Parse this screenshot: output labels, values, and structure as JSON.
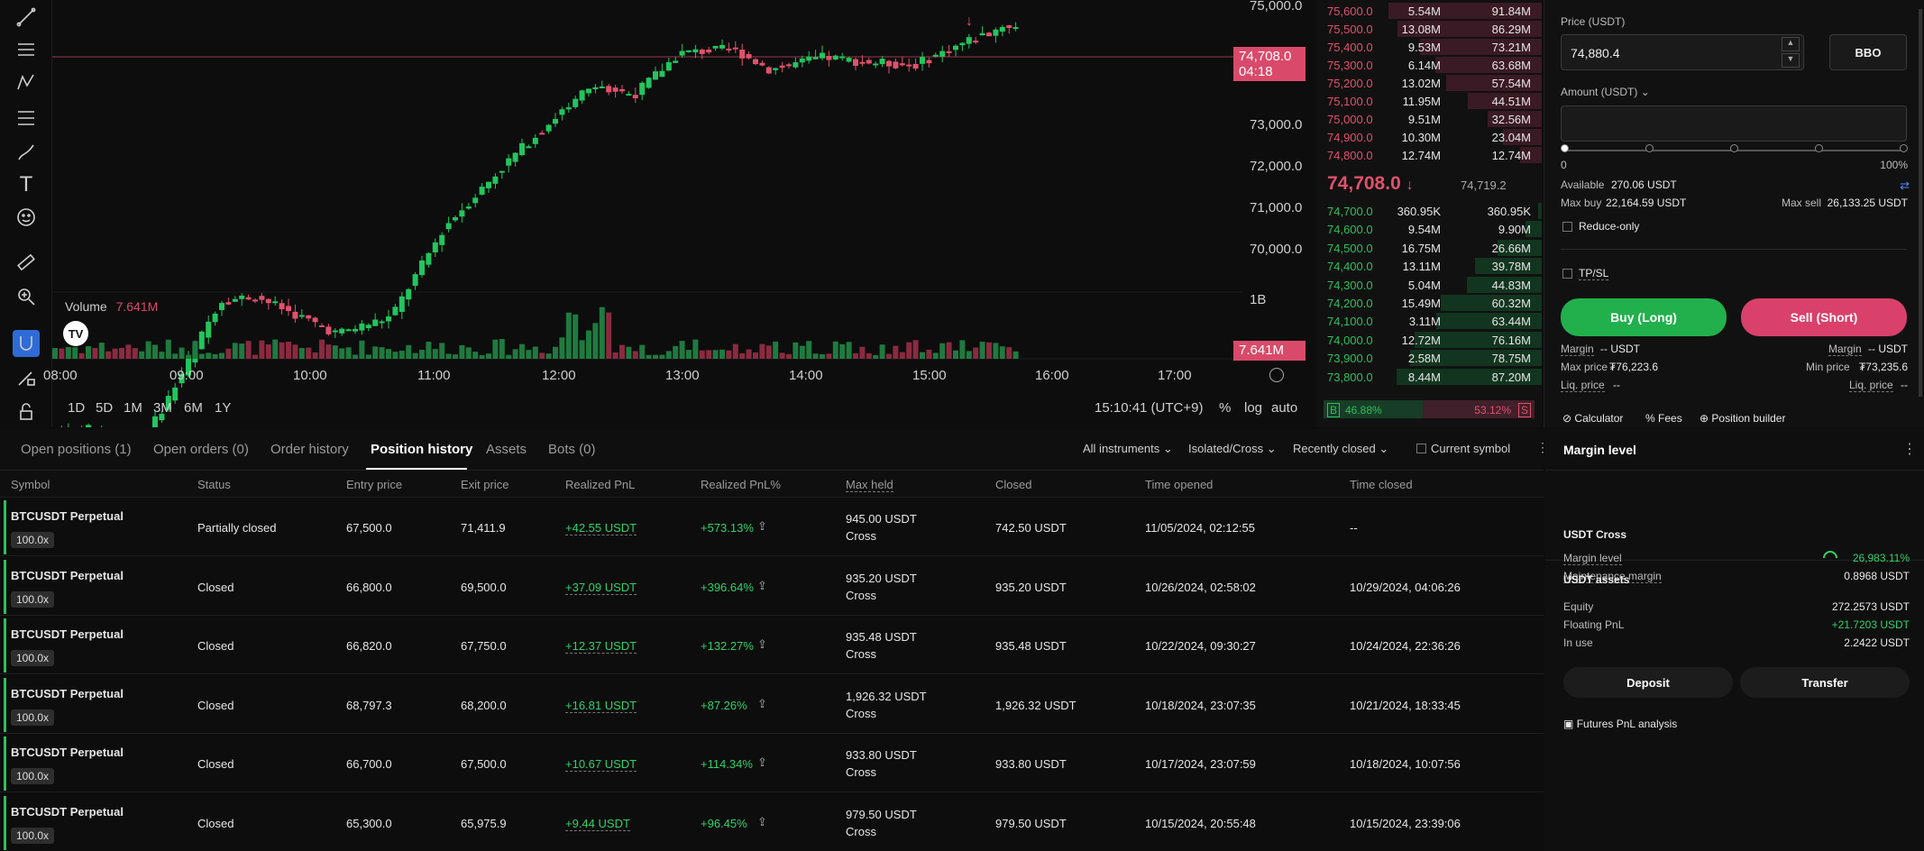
{
  "toolbar": {
    "icons": [
      "trend-line-icon",
      "horizontal-lines-icon",
      "pattern-icon",
      "fib-icon",
      "brush-icon",
      "text-icon",
      "emoji-icon",
      "ruler-icon",
      "zoom-in-icon",
      "magnet-icon",
      "lock-draw-icon",
      "lock-icon"
    ]
  },
  "chart": {
    "price_axis": [
      "75,000.0",
      "74,000.0",
      "73,000.0",
      "72,000.0",
      "71,000.0",
      "70,000.0"
    ],
    "last_price": "74,708.0",
    "countdown": "04:18",
    "volume_label": "Volume",
    "volume_value": "7.641M",
    "volume_axis": "1B",
    "volume_tag": "7.641M",
    "time_labels": [
      "08:00",
      "09:00",
      "10:00",
      "11:00",
      "12:00",
      "13:00",
      "14:00",
      "15:00",
      "16:00",
      "17:00"
    ],
    "timeframes": [
      "1D",
      "5D",
      "1M",
      "3M",
      "6M",
      "1Y"
    ],
    "clock": "15:10:41 (UTC+9)",
    "scale_pct": "%",
    "scale_log": "log",
    "scale_auto": "auto",
    "tv_logo": "TV"
  },
  "orderbook": {
    "asks": [
      [
        "75,600.0",
        "5.54M",
        "91.84M"
      ],
      [
        "75,500.0",
        "13.08M",
        "86.29M"
      ],
      [
        "75,400.0",
        "9.53M",
        "73.21M"
      ],
      [
        "75,300.0",
        "6.14M",
        "63.68M"
      ],
      [
        "75,200.0",
        "13.02M",
        "57.54M"
      ],
      [
        "75,100.0",
        "11.95M",
        "44.51M"
      ],
      [
        "75,000.0",
        "9.51M",
        "32.56M"
      ],
      [
        "74,900.0",
        "10.30M",
        "23.04M"
      ],
      [
        "74,800.0",
        "12.74M",
        "12.74M"
      ]
    ],
    "mid_price": "74,708.0",
    "mid_arrow": "↓",
    "mark_price": "74,719.2",
    "bids": [
      [
        "74,700.0",
        "360.95K",
        "360.95K"
      ],
      [
        "74,600.0",
        "9.54M",
        "9.90M"
      ],
      [
        "74,500.0",
        "16.75M",
        "26.66M"
      ],
      [
        "74,400.0",
        "13.11M",
        "39.78M"
      ],
      [
        "74,300.0",
        "5.04M",
        "44.83M"
      ],
      [
        "74,200.0",
        "15.49M",
        "60.32M"
      ],
      [
        "74,100.0",
        "3.11M",
        "63.44M"
      ],
      [
        "74,000.0",
        "12.72M",
        "76.16M"
      ],
      [
        "73,900.0",
        "2.58M",
        "78.75M"
      ],
      [
        "73,800.0",
        "8.44M",
        "87.20M"
      ]
    ],
    "buy_ratio_label": "B",
    "buy_ratio": "46.88%",
    "sell_ratio": "53.12%",
    "sell_ratio_label": "S"
  },
  "form": {
    "price_label": "Price (USDT)",
    "price_value": "74,880.4",
    "bbo": "BBO",
    "amount_label": "Amount (USDT)",
    "slider_min": "0",
    "slider_max": "100%",
    "available_label": "Available",
    "available_value": "270.06 USDT",
    "max_buy_label": "Max buy",
    "max_buy_value": "22,164.59 USDT",
    "max_sell_label": "Max sell",
    "max_sell_value": "26,133.25 USDT",
    "reduce_only": "Reduce-only",
    "tpsl": "TP/SL",
    "buy": "Buy (Long)",
    "sell": "Sell (Short)",
    "margin_buy_label": "Margin",
    "margin_buy_value": "-- USDT",
    "margin_sell_label": "Margin",
    "margin_sell_value": "-- USDT",
    "max_price_label": "Max price",
    "max_price_value": "₮76,223.6",
    "min_price_label": "Min price",
    "min_price_value": "₮73,235.6",
    "liq_buy_label": "Liq. price",
    "liq_buy_value": "--",
    "liq_sell_label": "Liq. price",
    "liq_sell_value": "--",
    "calculator": "Calculator",
    "fees": "Fees",
    "position_builder": "Position builder"
  },
  "tabs": {
    "items": [
      "Open positions (1)",
      "Open orders (0)",
      "Order history",
      "Position history",
      "Assets",
      "Bots (0)"
    ],
    "filters": [
      "All instruments",
      "Isolated/Cross",
      "Recently closed"
    ],
    "current_symbol": "Current symbol"
  },
  "table": {
    "headers": [
      "Symbol",
      "Status",
      "Entry price",
      "Exit price",
      "Realized PnL",
      "Realized PnL%",
      "Max held",
      "Closed",
      "Time opened",
      "Time closed"
    ],
    "rows": [
      {
        "symbol": "BTCUSDT Perpetual",
        "lev": "100.0x",
        "status": "Partially closed",
        "entry": "67,500.0",
        "exit": "71,411.9",
        "pnl": "+42.55 USDT",
        "pnlpct": "+573.13%",
        "max": "945.00 USDT",
        "mode": "Cross",
        "closed": "742.50 USDT",
        "opened": "11/05/2024, 02:12:55",
        "tclosed": "--"
      },
      {
        "symbol": "BTCUSDT Perpetual",
        "lev": "100.0x",
        "status": "Closed",
        "entry": "66,800.0",
        "exit": "69,500.0",
        "pnl": "+37.09 USDT",
        "pnlpct": "+396.64%",
        "max": "935.20 USDT",
        "mode": "Cross",
        "closed": "935.20 USDT",
        "opened": "10/26/2024, 02:58:02",
        "tclosed": "10/29/2024, 04:06:26"
      },
      {
        "symbol": "BTCUSDT Perpetual",
        "lev": "100.0x",
        "status": "Closed",
        "entry": "66,820.0",
        "exit": "67,750.0",
        "pnl": "+12.37 USDT",
        "pnlpct": "+132.27%",
        "max": "935.48 USDT",
        "mode": "Cross",
        "closed": "935.48 USDT",
        "opened": "10/22/2024, 09:30:27",
        "tclosed": "10/24/2024, 22:36:26"
      },
      {
        "symbol": "BTCUSDT Perpetual",
        "lev": "100.0x",
        "status": "Closed",
        "entry": "68,797.3",
        "exit": "68,200.0",
        "pnl": "+16.81 USDT",
        "pnlpct": "+87.26%",
        "max": "1,926.32 USDT",
        "mode": "Cross",
        "closed": "1,926.32 USDT",
        "opened": "10/18/2024, 23:07:35",
        "tclosed": "10/21/2024, 18:33:45"
      },
      {
        "symbol": "BTCUSDT Perpetual",
        "lev": "100.0x",
        "status": "Closed",
        "entry": "66,700.0",
        "exit": "67,500.0",
        "pnl": "+10.67 USDT",
        "pnlpct": "+114.34%",
        "max": "933.80 USDT",
        "mode": "Cross",
        "closed": "933.80 USDT",
        "opened": "10/17/2024, 23:07:59",
        "tclosed": "10/18/2024, 10:07:56"
      },
      {
        "symbol": "BTCUSDT Perpetual",
        "lev": "100.0x",
        "status": "Closed",
        "entry": "65,300.0",
        "exit": "65,975.9",
        "pnl": "+9.44 USDT",
        "pnlpct": "+96.45%",
        "max": "979.50 USDT",
        "mode": "Cross",
        "closed": "979.50 USDT",
        "opened": "10/15/2024, 20:55:48",
        "tclosed": "10/15/2024, 23:39:06"
      }
    ]
  },
  "margin": {
    "title": "Margin level",
    "cross_title": "USDT Cross",
    "margin_level_label": "Margin level",
    "margin_level_value": "26,983.11%",
    "maint_label": "Maintenance margin",
    "maint_value": "0.8968 USDT",
    "assets_title": "USDT assets",
    "equity_label": "Equity",
    "equity_value": "272.2573 USDT",
    "floating_label": "Floating PnL",
    "floating_value": "+21.7203 USDT",
    "inuse_label": "In use",
    "inuse_value": "2.2422 USDT",
    "deposit": "Deposit",
    "transfer": "Transfer",
    "analysis": "Futures PnL analysis"
  },
  "colors": {
    "up": "#22c55e",
    "down": "#e0516c",
    "accent": "#2f6bd6"
  }
}
